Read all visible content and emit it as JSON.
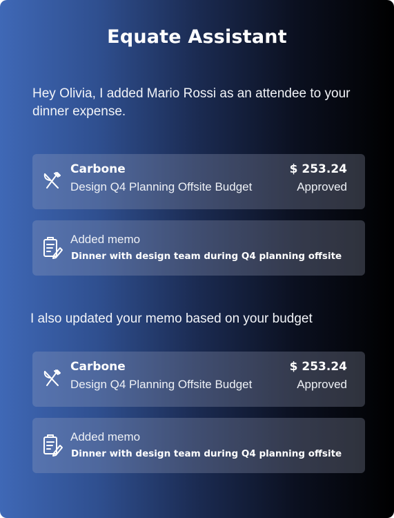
{
  "header": {
    "title": "Equate Assistant"
  },
  "messages": [
    "Hey Olivia, I added Mario Rossi as an attendee to your dinner expense.",
    "I also updated your memo based on your budget"
  ],
  "cards": [
    {
      "type": "expense",
      "icon": "fork-knife-icon",
      "merchant": "Carbone",
      "budget": "Design Q4 Planning Offsite Budget",
      "amount": "$ 253.24",
      "status": "Approved"
    },
    {
      "type": "memo",
      "icon": "memo-document-icon",
      "label": "Added memo",
      "memo": "Dinner with design team during Q4 planning offsite"
    },
    {
      "type": "expense",
      "icon": "fork-knife-icon",
      "merchant": "Carbone",
      "budget": "Design Q4 Planning Offsite Budget",
      "amount": "$ 253.24",
      "status": "Approved"
    },
    {
      "type": "memo",
      "icon": "memo-document-icon",
      "label": "Added memo",
      "memo": "Dinner with design team during Q4 planning offsite"
    }
  ],
  "colors": {
    "gradient_start": "#3f68b6",
    "gradient_end": "#000000",
    "card_background": "rgba(160,170,195,0.28)",
    "text": "#ffffff"
  }
}
